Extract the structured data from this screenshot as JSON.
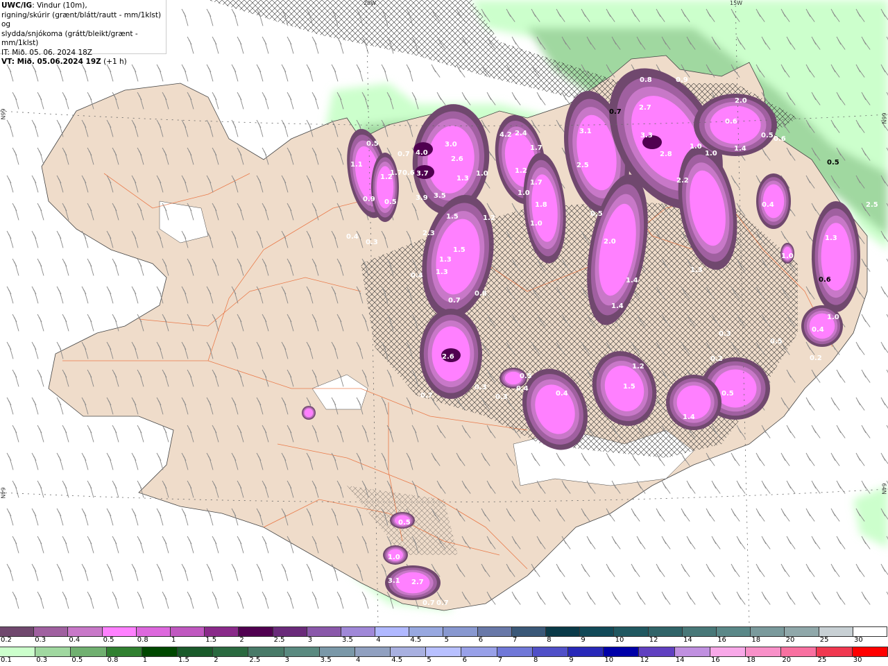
{
  "title": {
    "model": "UWC/IG",
    "line1": ": Vindur (10m),",
    "line2": "rigning/skúrir (grænt/blátt/rautt - mm/1klst) og",
    "line3": "slydda/snjókoma (grátt/bleikt/grænt - mm/1klst)",
    "it": "IT: Mið. 05. 06. 2024 18Z",
    "vt_bold": "VT: Mið. 05.06.2024 19Z",
    "vt_suffix": " (+1 h)"
  },
  "graticule": {
    "lon_20": "20W",
    "lon_15": "15W",
    "lat_66_left": "66N",
    "lat_66_right": "66N",
    "lat_64_left": "64N",
    "lat_64_right": "64N"
  },
  "map_labels": [
    "1.1",
    "1.2",
    "0.9",
    "0.5",
    "0.5",
    "0.7",
    "1.7",
    "0.6",
    "4.0",
    "3.0",
    "2.6",
    "3.7",
    "3.9",
    "3.5",
    "1.3",
    "1.0",
    "1.5",
    "2.3",
    "1.2",
    "1.5",
    "1.3",
    "1.3",
    "0.4",
    "0.3",
    "0.4",
    "0.7",
    "0.8",
    "2.6",
    "0.7",
    "0.3",
    "0.3",
    "0.5",
    "0.4",
    "4.2",
    "2.4",
    "1.7",
    "1.2",
    "1.7",
    "1.0",
    "1.8",
    "1.0",
    "3.1",
    "2.5",
    "0.5",
    "2.0",
    "1.4",
    "1.4",
    "0.7",
    "0.8",
    "2.7",
    "0.9",
    "3.3",
    "2.8",
    "1.0",
    "1.0",
    "1.4",
    "2.2",
    "1.3",
    "2.0",
    "0.6",
    "0.5",
    "0.6",
    "0.5",
    "2.5",
    "0.4",
    "1.0",
    "1.3",
    "0.6",
    "1.0",
    "0.4",
    "0.2",
    "0.3",
    "0.2",
    "0.5",
    "1.2",
    "1.5",
    "0.4",
    "1.4",
    "0.5",
    "1.0",
    "3.1",
    "2.7",
    "0.7",
    "0.7",
    "0.5"
  ],
  "colors": {
    "land": "#efdcca",
    "sea": "#ffffff",
    "rain_light": "#ccffcc",
    "snow_peak": "#ff80ff",
    "roads": "#e8622a"
  },
  "legend_snow": {
    "labels": [
      "0.2",
      "0.3",
      "0.4",
      "0.5",
      "0.8",
      "1",
      "1.5",
      "2",
      "2.5",
      "3",
      "3.5",
      "4",
      "4.5",
      "5",
      "6",
      "7",
      "8",
      "9",
      "10",
      "12",
      "14",
      "16",
      "18",
      "20",
      "25",
      "30"
    ],
    "colors": [
      "#70486e",
      "#a060a0",
      "#c878c8",
      "#ff80ff",
      "#dd68dd",
      "#c058c0",
      "#8a2a8a",
      "#500050",
      "#6a2a7a",
      "#8a58aa",
      "#a088d8",
      "#b0b8ff",
      "#98a8e0",
      "#8898d0",
      "#6878a8",
      "#3a5878",
      "#0a3a48",
      "#124a58",
      "#205860",
      "#306468",
      "#487878",
      "#5a8888",
      "#7a9a9c",
      "#90a8aa",
      "#c8d0d4",
      "#ffffff"
    ]
  },
  "legend_rain": {
    "labels": [
      "0.1",
      "0.3",
      "0.5",
      "0.8",
      "1",
      "1.5",
      "2",
      "2.5",
      "3",
      "3.5",
      "4",
      "4.5",
      "5",
      "6",
      "7",
      "8",
      "9",
      "10",
      "12",
      "14",
      "16",
      "18",
      "20",
      "25",
      "30"
    ],
    "colors": [
      "#ccffcc",
      "#a0d8a0",
      "#70b070",
      "#308030",
      "#004800",
      "#1a5a2a",
      "#2a6a40",
      "#487a68",
      "#5a8a80",
      "#7a98a8",
      "#90a0c0",
      "#a8b0e0",
      "#b8c0ff",
      "#98a0e8",
      "#7078d8",
      "#5050c8",
      "#2828b8",
      "#0000a8",
      "#6040c0",
      "#c090e0",
      "#f8a8e8",
      "#f890c8",
      "#f870a0",
      "#f03850",
      "#ff0000"
    ]
  }
}
